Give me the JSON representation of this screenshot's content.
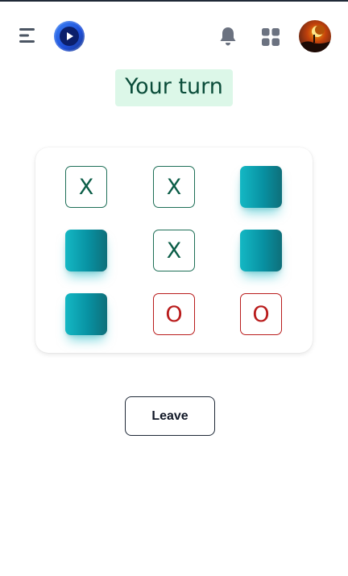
{
  "header": {
    "menu_icon": "hamburger-menu-icon",
    "logo_icon": "play-logo-icon",
    "bell_icon": "bell-icon",
    "apps_icon": "apps-grid-icon",
    "avatar": "user-avatar"
  },
  "status": {
    "text": "Your turn"
  },
  "board": {
    "cells": [
      {
        "mark": "X",
        "state": "x"
      },
      {
        "mark": "X",
        "state": "x"
      },
      {
        "mark": "",
        "state": "empty"
      },
      {
        "mark": "",
        "state": "empty"
      },
      {
        "mark": "X",
        "state": "x"
      },
      {
        "mark": "",
        "state": "empty"
      },
      {
        "mark": "",
        "state": "empty"
      },
      {
        "mark": "O",
        "state": "o"
      },
      {
        "mark": "O",
        "state": "o"
      }
    ]
  },
  "actions": {
    "leave_label": "Leave"
  },
  "colors": {
    "status_bg": "#dcf7e8",
    "x_color": "#0b5d47",
    "o_color": "#b91c1c",
    "empty_cell": "#0e9fad"
  }
}
